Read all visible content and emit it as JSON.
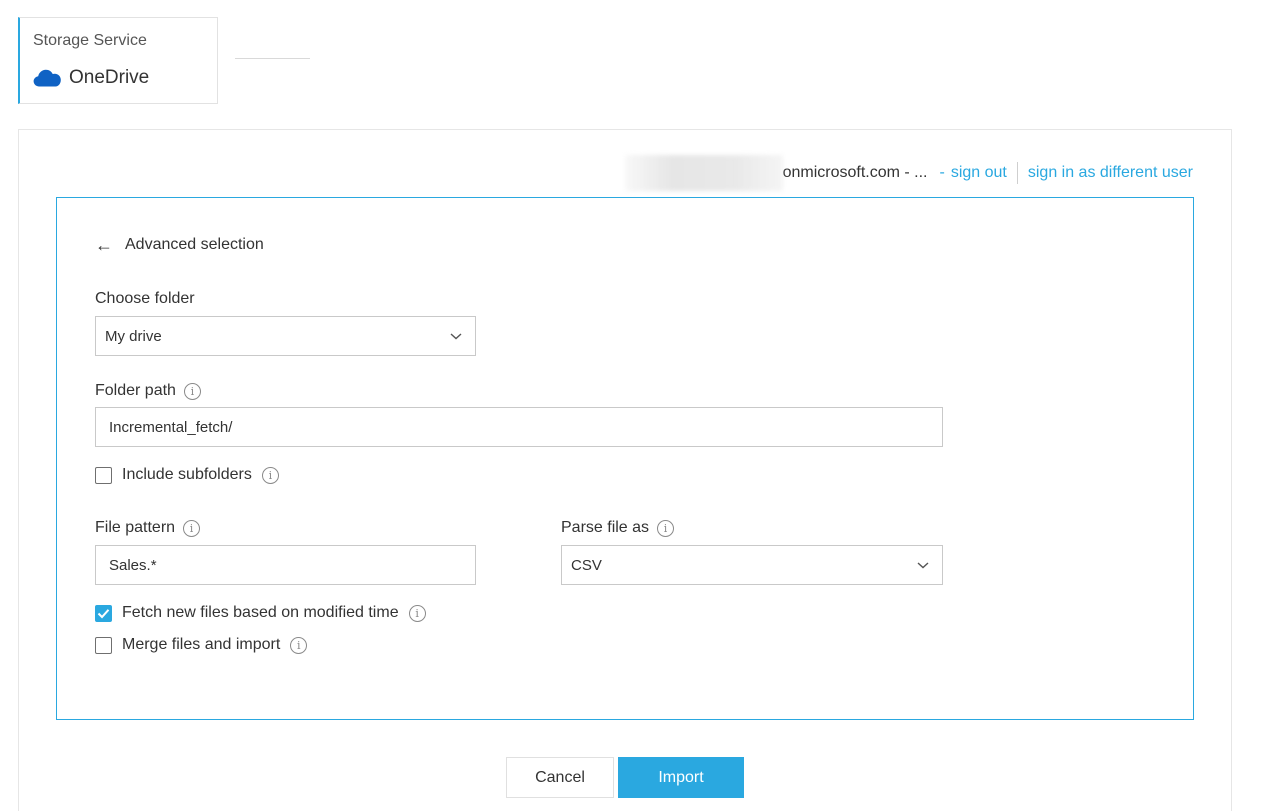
{
  "service": {
    "label": "Storage Service",
    "name": "OneDrive",
    "icon": "onedrive-cloud-icon"
  },
  "account": {
    "domain": "onmicrosoft.com - ...",
    "dash": "-",
    "sign_out": "sign out",
    "sign_in_different": "sign in as different user"
  },
  "selection": {
    "back_label": "Advanced selection",
    "choose_folder": {
      "label": "Choose folder",
      "value": "My drive"
    },
    "folder_path": {
      "label": "Folder path",
      "value": "Incremental_fetch/"
    },
    "include_subfolders": {
      "label": "Include subfolders",
      "checked": false
    },
    "file_pattern": {
      "label": "File pattern",
      "value": "Sales.*"
    },
    "parse_file_as": {
      "label": "Parse file as",
      "value": "CSV"
    },
    "fetch_new_files": {
      "label": "Fetch new files based on modified time",
      "checked": true
    },
    "merge_files": {
      "label": "Merge files and import",
      "checked": false
    }
  },
  "buttons": {
    "cancel": "Cancel",
    "import": "Import"
  },
  "colors": {
    "accent": "#2aa8e0",
    "onedrive_blue": "#0f62c4"
  }
}
